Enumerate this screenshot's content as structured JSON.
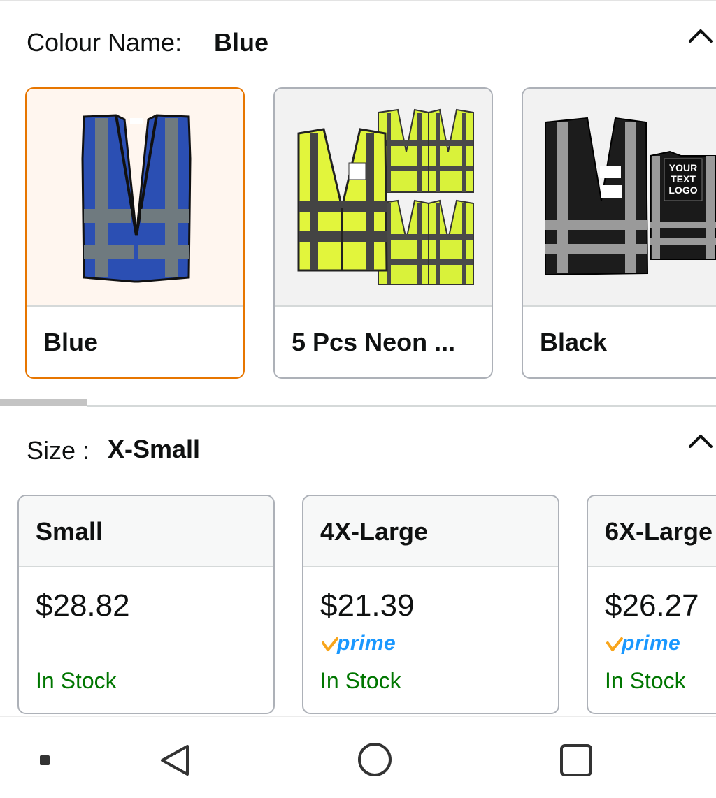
{
  "colour": {
    "label": "Colour Name:",
    "selected": "Blue",
    "options": [
      {
        "name": "Blue",
        "selected": true
      },
      {
        "name": "5 Pcs Neon ...",
        "selected": false
      },
      {
        "name": "Black",
        "selected": false
      }
    ]
  },
  "size": {
    "label": "Size :",
    "selected": "X-Small",
    "options": [
      {
        "name": "Small",
        "price": "$28.82",
        "prime": false,
        "stock": "In Stock"
      },
      {
        "name": "4X-Large",
        "price": "$21.39",
        "prime": true,
        "stock": "In Stock"
      },
      {
        "name": "6X-Large",
        "price": "$26.27",
        "prime": true,
        "stock": "In Stock"
      }
    ]
  },
  "prime_label": "prime",
  "vest_texts": {
    "logo_text": "YOUR TEXT LOGO"
  },
  "colors": {
    "selected_border": "#e77600",
    "in_stock": "#007600",
    "prime_blue": "#1a98ff",
    "prime_check": "#f8a51c"
  },
  "navbar": {
    "icons": [
      "menu-dot-icon",
      "back-icon",
      "home-icon",
      "recents-icon"
    ]
  }
}
